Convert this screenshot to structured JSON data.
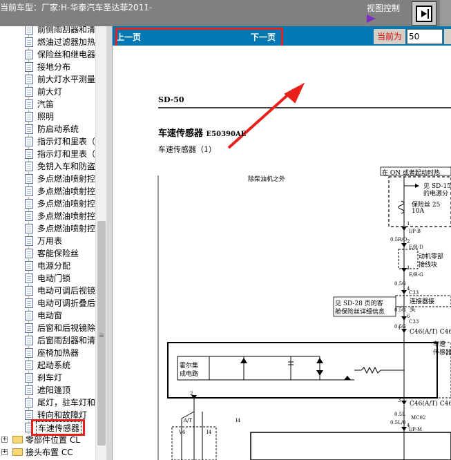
{
  "header": {
    "title": "当前车型：厂家:H-华泰汽车圣达菲2011-",
    "view_control_label": "视图控制"
  },
  "nav": {
    "prev_label": "上一页",
    "next_label": "下一页",
    "current_label": "当前为",
    "current_page": "50"
  },
  "tree": {
    "items": [
      "前侧雨刮器和清",
      "燃油过滤器加热",
      "保险丝和继电器",
      "接地分布",
      "前大灯水平测量",
      "前大灯",
      "汽笛",
      "照明",
      "防启动系统",
      "指示灯和里表（",
      "指示灯和里表（",
      "免钥入车和防盗",
      "多点燃油喷射控",
      "多点燃油喷射控",
      "多点燃油喷射控",
      "多点燃油喷射控",
      "多点燃油喷射控",
      "万用表",
      "客能保险丝",
      "电源分配",
      "电动门锁",
      "电动可调后视镜",
      "电动可调折叠后",
      "电动窗",
      "后窗和后视镜除",
      "后窗雨刮器和清",
      "座椅加热器",
      "起动系统",
      "刹车灯",
      "遮阳篷顶",
      "尾灯，驻车灯和",
      "转向和故障灯",
      "车速传感器"
    ],
    "folders": [
      "零部件位置 CL",
      "接头布置 CC"
    ]
  },
  "document": {
    "page_code": "SD-50",
    "title": "车速传感器",
    "title_code": "E50390AE",
    "subtitle": "车速传感器（1）",
    "condition": "除柴油机之外",
    "power_note": "在 ON 或者起动时热",
    "ref1": "见 SD-15",
    "ref1b": "的电源分",
    "fuse_label": "保险丝 25",
    "fuse_rating": "10A",
    "c1": "1",
    "c1_pin": "I/P-B",
    "w1": "0.5R/O",
    "c2": "2",
    "c2_pin": "E/R-D",
    "c2_note": "动机零部",
    "c2_note2": "接线块",
    "c3": "1",
    "c3_pin": "E/R-G",
    "w3": "0.5G",
    "c4": "4",
    "c4_pin": "C33",
    "connector_note": "连接器接",
    "connector_note2": "头",
    "ref2": "见 SD-28 页的客",
    "ref2b": "舱保险丝详细信息",
    "w4": "0.5G",
    "c5": "6",
    "c5_pin": "C33",
    "w5": "0.5G",
    "c6": "1",
    "c6_pin": "C46(A/T) C46",
    "sensor_note": "车速",
    "sensor_note2": "传感器",
    "hall_label": "霍尔集",
    "hall_label2": "成电路",
    "c7": "3",
    "c7_pin": "C46(A/T) C46",
    "w7": "0.5L",
    "w7b": "0.5L/0",
    "c8": "4",
    "c8_pin": "I/P-M",
    "mc02": "MC02",
    "at_label": "A/T",
    "mt_label": "I4",
    "v6": "V6",
    "i4": "I4",
    "pin2": "2"
  }
}
